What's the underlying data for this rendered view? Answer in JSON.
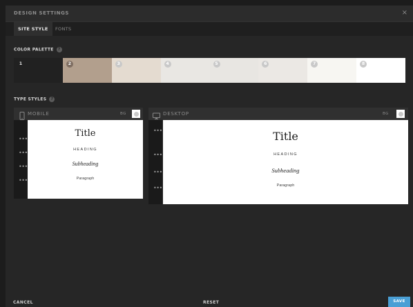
{
  "window": {
    "title": "DESIGN SETTINGS",
    "close_glyph": "×"
  },
  "tabs": [
    {
      "label": "SITE STYLE",
      "active": true
    },
    {
      "label": "FONTS",
      "active": false
    }
  ],
  "color_palette": {
    "label": "COLOR PALETTE",
    "help_glyph": "?",
    "swatches": [
      {
        "number": "1",
        "color": "#212121"
      },
      {
        "number": "2",
        "color": "#b29f8d"
      },
      {
        "number": "3",
        "color": "#e4dbd0"
      },
      {
        "number": "4",
        "color": "#e9e7e3"
      },
      {
        "number": "5",
        "color": "#e8e6e2"
      },
      {
        "number": "6",
        "color": "#ebe8e4"
      },
      {
        "number": "7",
        "color": "#f7f6f2"
      },
      {
        "number": "8",
        "color": "#ffffff"
      }
    ]
  },
  "type_styles": {
    "label": "TYPE STYLES",
    "help_glyph": "?",
    "mobile": {
      "name": "MOBILE",
      "icon": "mobile-phone-icon",
      "bg_label": "BG",
      "bg_color": "#ffffff",
      "samples": {
        "title": "Title",
        "heading": "HEADING",
        "subheading": "Subheading",
        "paragraph": "Paragraph"
      }
    },
    "desktop": {
      "name": "DESKTOP",
      "icon": "desktop-monitor-icon",
      "bg_label": "BG",
      "bg_color": "#ffffff",
      "samples": {
        "title": "Title",
        "heading": "HEADING",
        "subheading": "Subheading",
        "paragraph": "Paragraph"
      }
    },
    "row_menu_glyph": "•••"
  },
  "footer": {
    "cancel": "CANCEL",
    "reset": "RESET",
    "save": "SAVE"
  },
  "colors": {
    "accent": "#4a9fd5",
    "panel_bg": "#262626"
  }
}
